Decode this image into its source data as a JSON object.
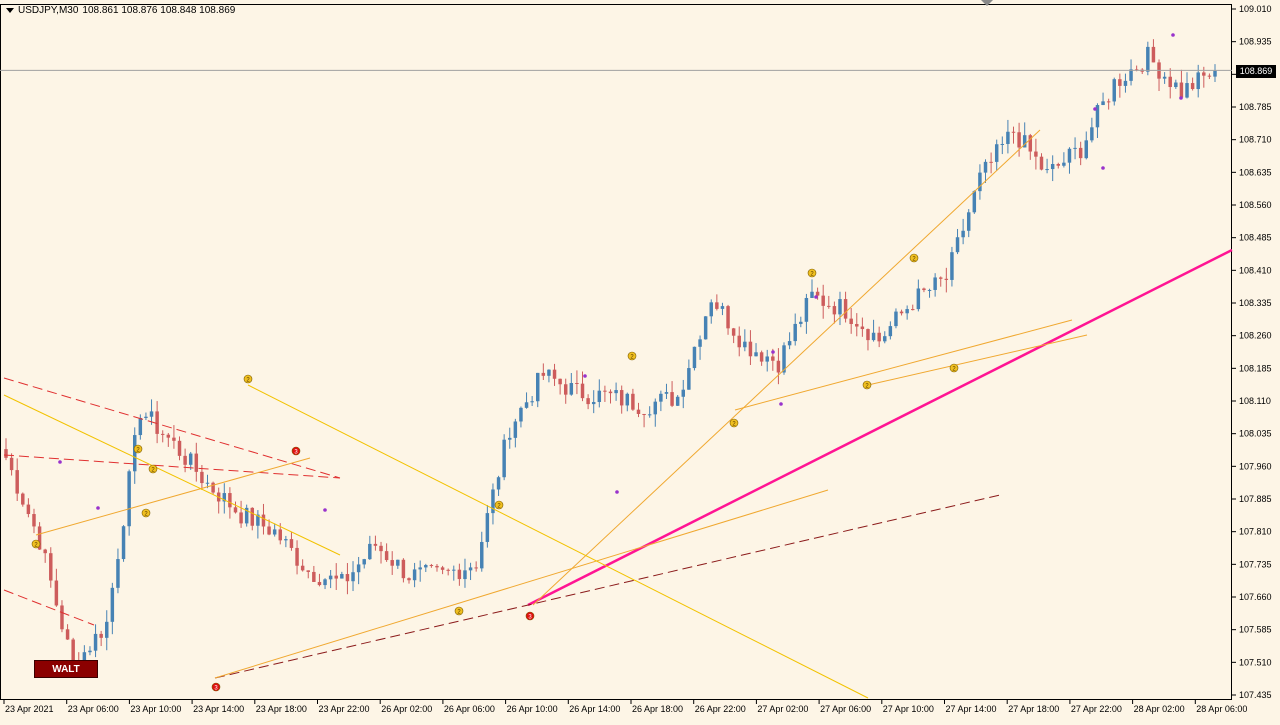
{
  "header": {
    "symbol_label": "USDJPY,M30",
    "ohlc": "108.861 108.876 108.848 108.869"
  },
  "button": {
    "walt_label": "WALT"
  },
  "price_marker": {
    "label": "108.869"
  },
  "colors": {
    "background": "#fdf5e6",
    "bull": "#4682b4",
    "bear": "#cd5c5c",
    "trend_main": "#ff1493",
    "trend_orange": "#f0a830",
    "trend_yellow": "#f2c200",
    "dash_red": "#e03030",
    "dash_darkred": "#8b1a1a",
    "marker_fill": "#f0c020",
    "marker_red": "#e01010",
    "wick_top": "#9932cc"
  },
  "chart_data": {
    "type": "candlestick",
    "symbol": "USDJPY",
    "timeframe": "M30",
    "y_ticks": [
      "109.010",
      "108.935",
      "108.860",
      "108.785",
      "108.710",
      "108.635",
      "108.560",
      "108.485",
      "108.410",
      "108.335",
      "108.260",
      "108.185",
      "108.110",
      "108.035",
      "107.960",
      "107.885",
      "107.810",
      "107.735",
      "107.660",
      "107.585",
      "107.510",
      "107.435"
    ],
    "ylim": [
      107.435,
      109.01
    ],
    "x_ticks": [
      "23 Apr 2021",
      "23 Apr 06:00",
      "23 Apr 10:00",
      "23 Apr 14:00",
      "23 Apr 18:00",
      "23 Apr 22:00",
      "26 Apr 02:00",
      "26 Apr 06:00",
      "26 Apr 10:00",
      "26 Apr 14:00",
      "26 Apr 18:00",
      "26 Apr 22:00",
      "27 Apr 02:00",
      "27 Apr 06:00",
      "27 Apr 10:00",
      "27 Apr 14:00",
      "27 Apr 18:00",
      "27 Apr 22:00",
      "28 Apr 02:00",
      "28 Apr 06:00"
    ],
    "current_price": 108.869,
    "anchors": [
      107.98,
      107.79,
      107.5,
      107.6,
      108.09,
      108.01,
      107.92,
      107.85,
      107.81,
      107.72,
      107.69,
      107.78,
      107.71,
      107.71,
      107.74,
      108.05,
      108.17,
      108.13,
      108.12,
      108.1,
      108.12,
      108.35,
      108.24,
      108.2,
      108.35,
      108.32,
      108.25,
      108.34,
      108.39,
      108.62,
      108.73,
      108.63,
      108.69,
      108.84,
      108.9,
      108.82,
      108.868
    ],
    "anchor_step": 6
  }
}
